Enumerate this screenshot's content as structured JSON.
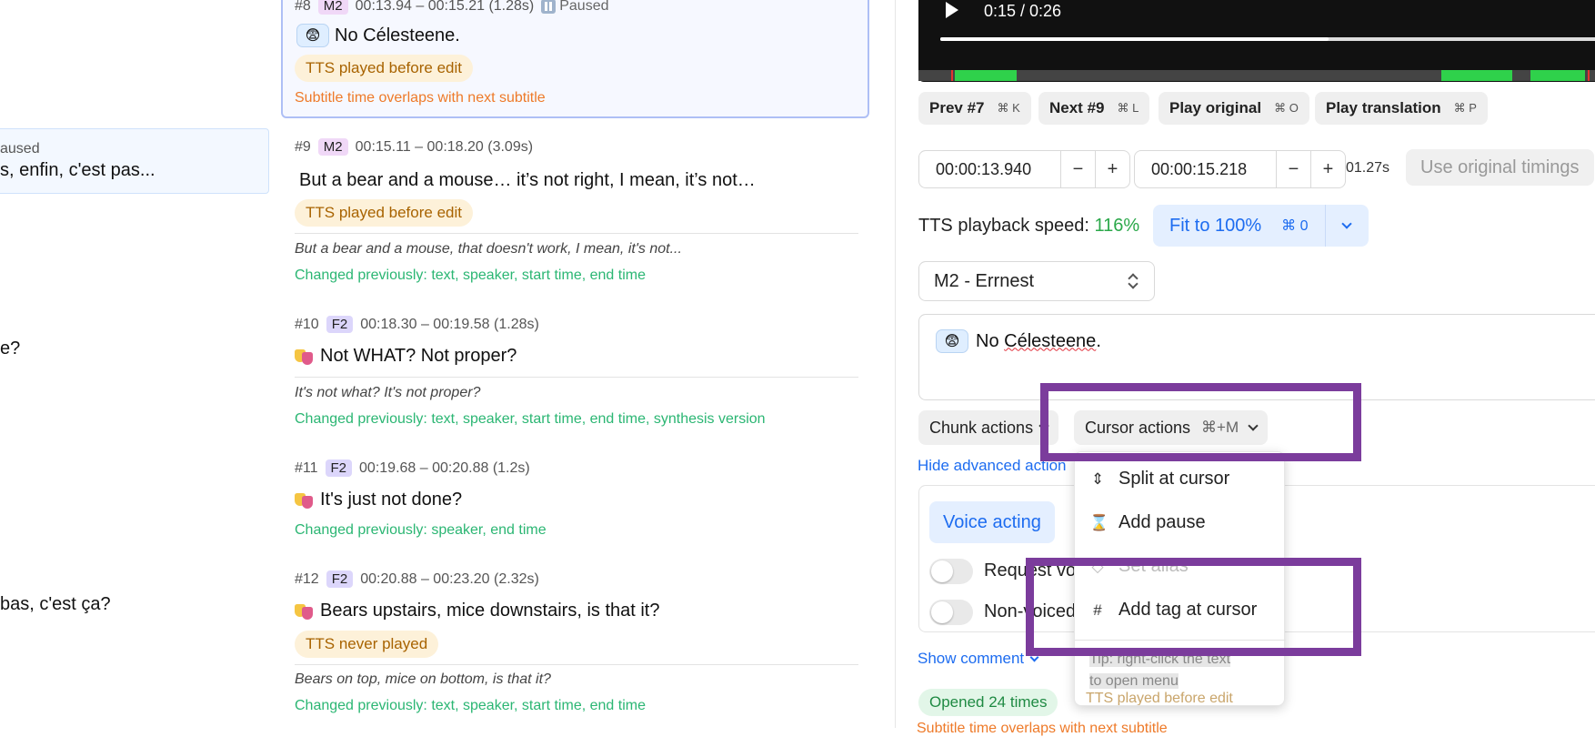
{
  "left_panel": {
    "status_fragment": "aused",
    "text_1": "s, enfin, c'est pas...",
    "text_2": "e?",
    "text_3": "bas, c'est ça?"
  },
  "subtitles": [
    {
      "num": "#8",
      "speaker": "M2",
      "time": "00:13.94 – 00:15.21 (1.28s)",
      "status": "Paused",
      "text": "No Célesteene.",
      "tts_status": "TTS played before edit",
      "warning": "Subtitle time overlaps with next subtitle",
      "emoji": "😨"
    },
    {
      "num": "#9",
      "speaker": "M2",
      "time": "00:15.11 – 00:18.20 (3.09s)",
      "text": "But a bear and a mouse… it’s not right, I mean, it’s not…",
      "tts_status": "TTS played before edit",
      "original": "But a bear and a mouse, that doesn't work, I mean, it's not...",
      "changed": "Changed previously: text, speaker, start time, end time"
    },
    {
      "num": "#10",
      "speaker": "F2",
      "time": "00:18.30 – 00:19.58 (1.28s)",
      "text": "Not WHAT? Not proper?",
      "original": "It's not what? It's not proper?",
      "changed": "Changed previously: text, speaker, start time, end time, synthesis version"
    },
    {
      "num": "#11",
      "speaker": "F2",
      "time": "00:19.68 – 00:20.88 (1.2s)",
      "text": "It's just not done?",
      "changed": "Changed previously: speaker, end time"
    },
    {
      "num": "#12",
      "speaker": "F2",
      "time": "00:20.88 – 00:23.20 (2.32s)",
      "text": "Bears upstairs, mice downstairs, is that it?",
      "tts_status": "TTS never played",
      "original": "Bears on top, mice on bottom, is that it?",
      "changed": "Changed previously: text, speaker, start time, end time"
    }
  ],
  "video": {
    "time": "0:15 / 0:26",
    "progress": 0.58
  },
  "nav": {
    "prev": "Prev #7",
    "prev_kbd": "⌘ K",
    "next": "Next #9",
    "next_kbd": "⌘ L",
    "play_original": "Play original",
    "play_original_kbd": "⌘ O",
    "play_translation": "Play translation",
    "play_translation_kbd": "⌘ P"
  },
  "timing": {
    "start": "00:00:13.940",
    "end": "00:00:15.218",
    "duration": "01.27s",
    "use_original": "Use original timings",
    "minus": "−",
    "plus": "+"
  },
  "tts_speed": {
    "label": "TTS playback speed:",
    "value": "116%",
    "fit_label": "Fit to 100%",
    "fit_kbd": "⌘ 0"
  },
  "speaker_select": {
    "value": "M2 - Errnest"
  },
  "editor": {
    "emoji": "😨",
    "text_plain": "No ",
    "text_misspelled": "Célesteene",
    "text_end": "."
  },
  "actions": {
    "chunk": "Chunk actions",
    "cursor": "Cursor actions",
    "cursor_kbd": "⌘+M",
    "hide_advanced": "Hide advanced action"
  },
  "advanced": {
    "voice_tab": "Voice acting",
    "toggle_1": "Request vo",
    "toggle_2": "Non-voiced",
    "show_comment": "Show comment",
    "opened": "Opened 24 times",
    "bottom_warning": "Subtitle time overlaps with next subtitle"
  },
  "menu": {
    "split": "Split at cursor",
    "pause": "Add pause",
    "alias": "Set alias",
    "tag": "Add tag at cursor",
    "tip_1": "Tip: right-click the text",
    "tip_2": "to open menu",
    "hidden_pill": "TTS played before edit"
  },
  "colors": {
    "highlight": "#7b3c9c",
    "accent": "#1d6cf0",
    "green": "#2bb673",
    "warning": "#ee7a29"
  }
}
